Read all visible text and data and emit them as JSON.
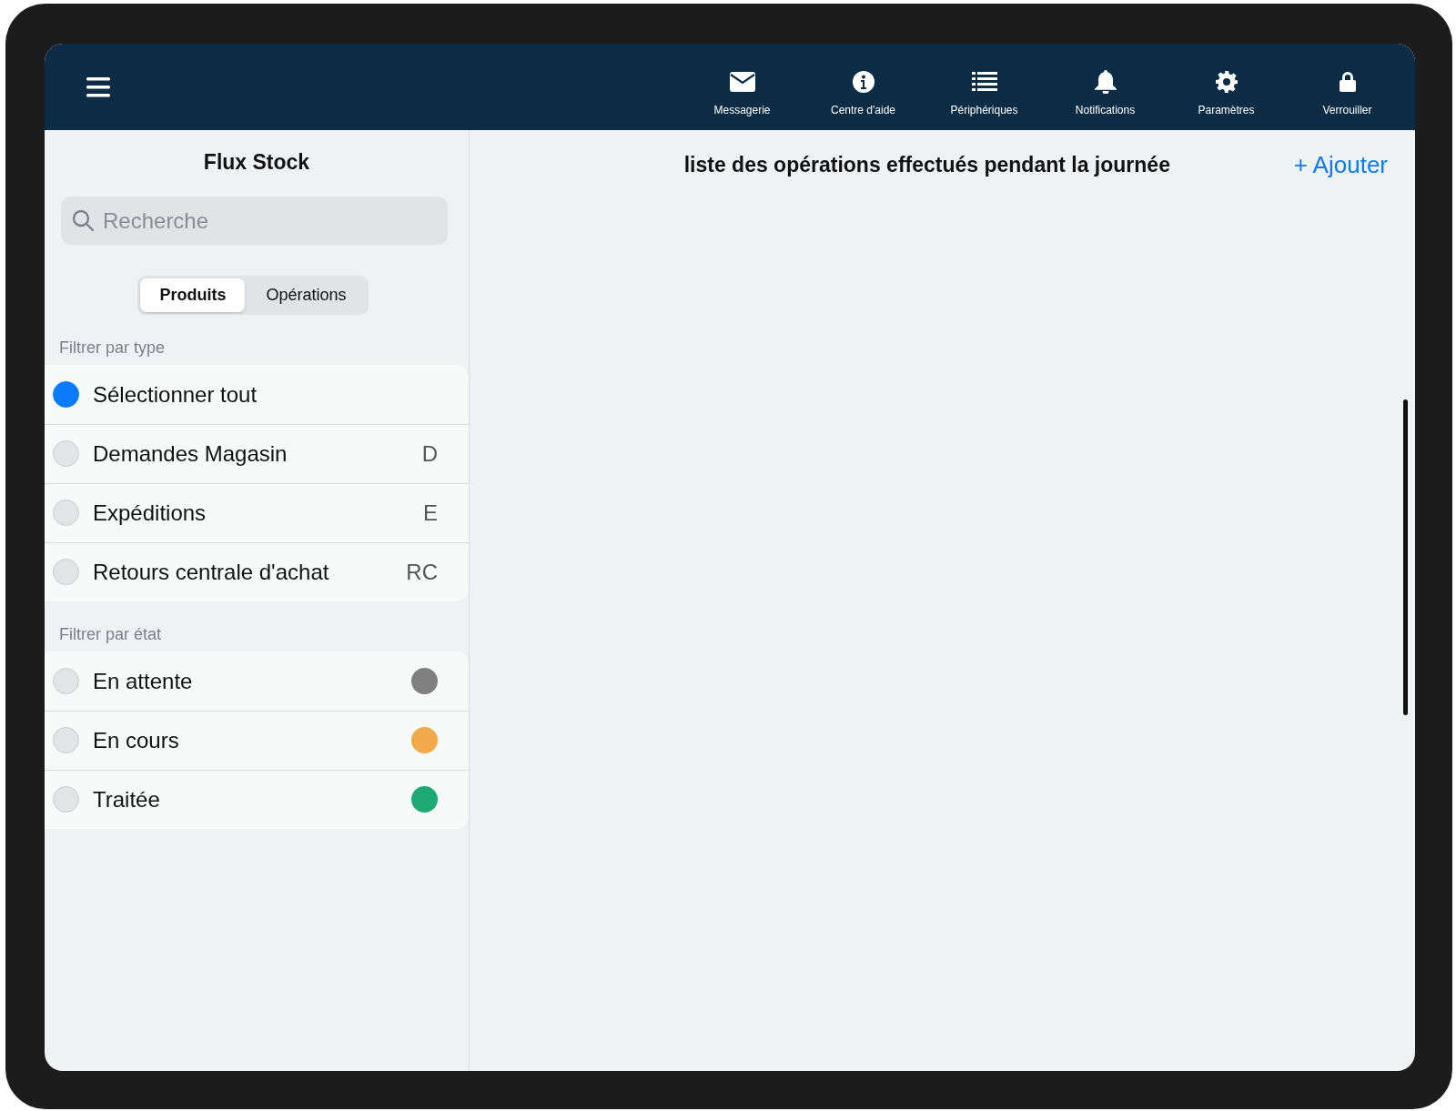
{
  "top_bar": {
    "items": [
      {
        "kind": "mail",
        "label": "Messagerie"
      },
      {
        "kind": "info",
        "label": "Centre d'aide"
      },
      {
        "kind": "list",
        "label": "Périphériques"
      },
      {
        "kind": "bell",
        "label": "Notifications"
      },
      {
        "kind": "gear",
        "label": "Paramètres"
      },
      {
        "kind": "lock",
        "label": "Verrouiller"
      }
    ]
  },
  "sidebar": {
    "title": "Flux Stock",
    "search": {
      "placeholder": "Recherche"
    },
    "segments": [
      {
        "label": "Produits",
        "selected": true
      },
      {
        "label": "Opérations",
        "selected": false
      }
    ],
    "type_filter": {
      "heading": "Filtrer par type",
      "items": [
        {
          "label": "Sélectionner tout",
          "selected": true
        },
        {
          "label": "Demandes Magasin",
          "selected": false,
          "code": "D"
        },
        {
          "label": "Expéditions",
          "selected": false,
          "code": "E"
        },
        {
          "label": "Retours centrale d'achat",
          "selected": false,
          "code": "RC"
        }
      ]
    },
    "state_filter": {
      "heading": "Filtrer par état",
      "items": [
        {
          "label": "En attente",
          "selected": false,
          "color": "#808080"
        },
        {
          "label": "En cours",
          "selected": false,
          "color": "#f0aa4a"
        },
        {
          "label": "Traitée",
          "selected": false,
          "color": "#1ea874"
        }
      ]
    }
  },
  "main": {
    "title": "liste des opérations effectués pendant la journée",
    "add_button": "+ Ajouter"
  }
}
